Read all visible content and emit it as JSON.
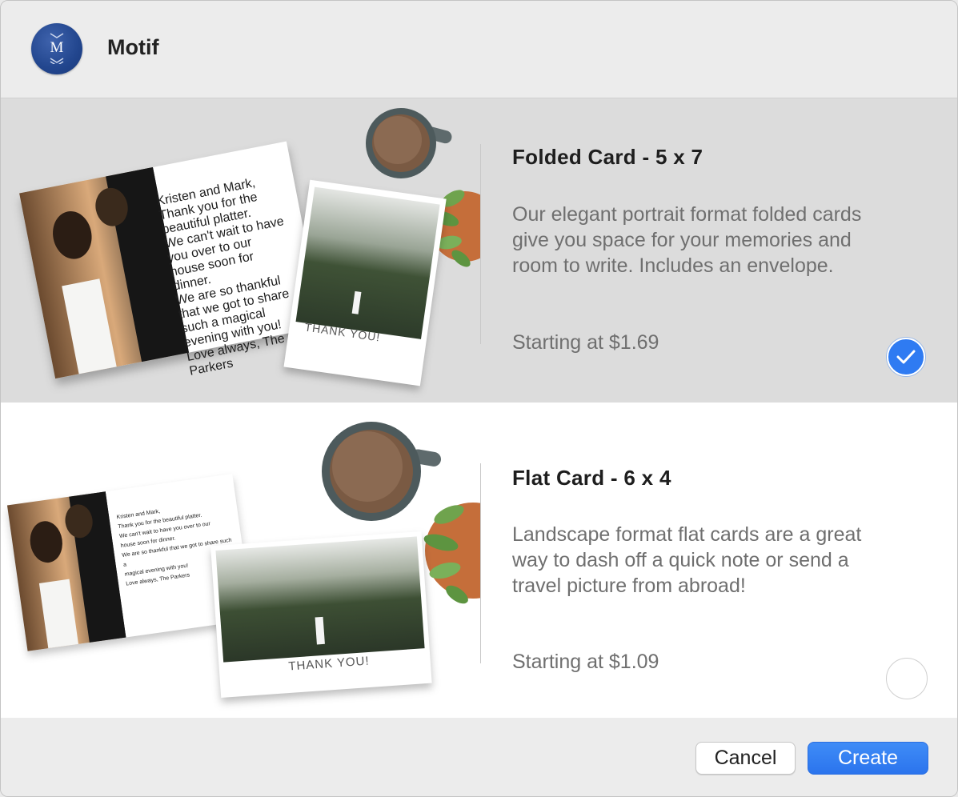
{
  "app": {
    "title": "Motif"
  },
  "options": [
    {
      "title": "Folded Card - 5 x 7",
      "description": "Our elegant portrait format folded cards give you space for your memories and room to write. Includes an envelope.",
      "price": "Starting at $1.69",
      "selected": true,
      "card_message": [
        "Kristen and Mark,",
        "Thank you for the beautiful platter.",
        "We can't wait to have you over to our",
        "house soon for dinner.",
        "We are so thankful that we got to share",
        "such a magical evening with you!",
        "Love always, The Parkers"
      ],
      "card_footer": "THANK YOU!"
    },
    {
      "title": "Flat Card - 6 x 4",
      "description": "Landscape format flat cards are a great way to dash off a quick note or send a travel picture from abroad!",
      "price": "Starting at $1.09",
      "selected": false,
      "card_message": [
        "Kristen and Mark,",
        "Thank you for the beautiful platter.",
        "We can't wait to have you over to our",
        "house soon for dinner.",
        "We are so thankful that we got to share such a",
        "magical evening with you!",
        "Love always, The Parkers"
      ],
      "card_footer": "THANK YOU!"
    }
  ],
  "buttons": {
    "cancel": "Cancel",
    "create": "Create"
  },
  "colors": {
    "accent": "#2f7bf2",
    "selected_bg": "#dcdcdc",
    "logo": "#22468e"
  },
  "logo_letter": "M"
}
